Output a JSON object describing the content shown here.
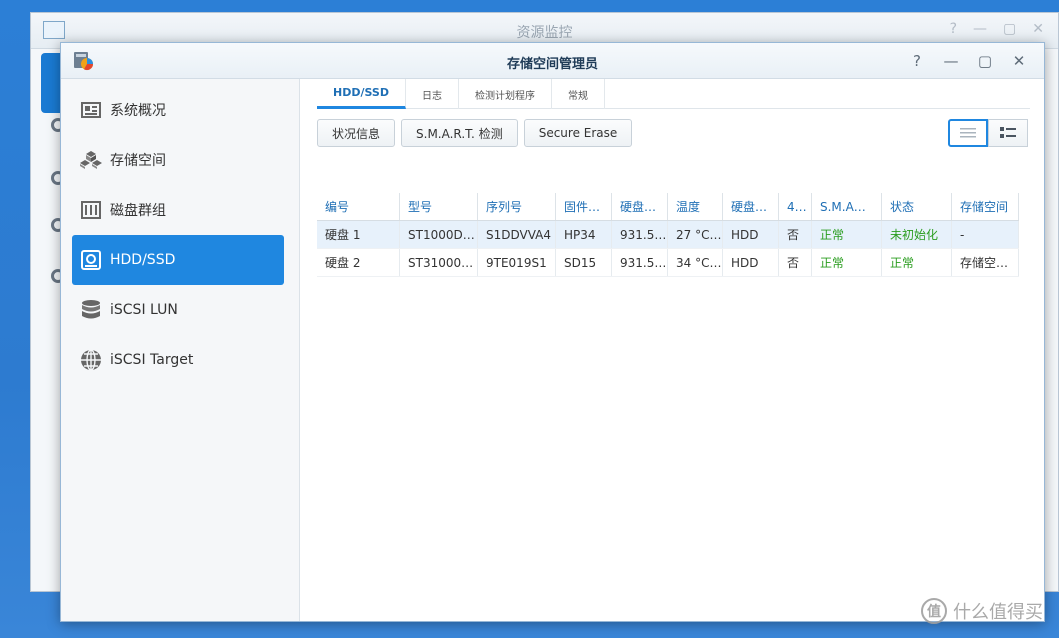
{
  "back_window": {
    "title": "资源监控"
  },
  "window": {
    "title": "存储空间管理员",
    "controls": [
      "?",
      "—",
      "▢",
      "✕"
    ]
  },
  "sidebar": {
    "items": [
      {
        "label": "系统概况",
        "icon": "overview-icon"
      },
      {
        "label": "存储空间",
        "icon": "cubes-icon"
      },
      {
        "label": "磁盘群组",
        "icon": "disk-group-icon"
      },
      {
        "label": "HDD/SSD",
        "icon": "hdd-icon",
        "active": true
      },
      {
        "label": "iSCSI LUN",
        "icon": "database-icon"
      },
      {
        "label": "iSCSI Target",
        "icon": "globe-icon"
      }
    ]
  },
  "tabs": [
    "HDD/SSD",
    "日志",
    "检测计划程序",
    "常规"
  ],
  "toolbar": {
    "status_info": "状况信息",
    "smart_test": "S.M.A.R.T. 检测",
    "secure_erase": "Secure Erase"
  },
  "table": {
    "headers": [
      "编号",
      "型号",
      "序列号",
      "固件…",
      "硬盘…",
      "温度",
      "硬盘…",
      "4…",
      "S.M.A…",
      "状态",
      "存储空间"
    ],
    "rows": [
      [
        "硬盘 1",
        "ST1000D…",
        "S1DDVVA4",
        "HP34",
        "931.5…",
        "27 °C…",
        "HDD",
        "否",
        "正常",
        "未初始化",
        "-"
      ],
      [
        "硬盘 2",
        "ST31000…",
        "9TE019S1",
        "SD15",
        "931.5…",
        "34 °C…",
        "HDD",
        "否",
        "正常",
        "正常",
        "存储空…"
      ]
    ]
  },
  "watermark": {
    "logo": "值",
    "text": "什么值得买"
  },
  "colors": {
    "accent": "#1f87e0",
    "ok_green": "#2a9d1f",
    "desktop": "#2c7fd6"
  }
}
